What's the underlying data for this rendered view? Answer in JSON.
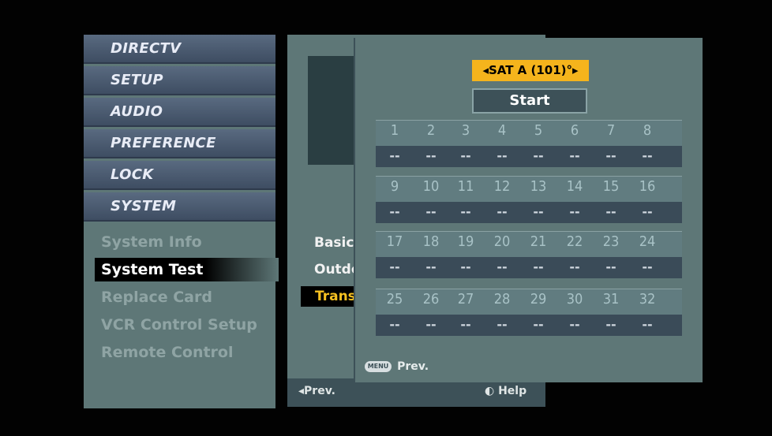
{
  "menu_tabs": [
    "DIRECTV",
    "SETUP",
    "AUDIO",
    "PREFERENCE",
    "LOCK",
    "SYSTEM"
  ],
  "system_submenu": {
    "items": [
      "System Info",
      "System Test",
      "Replace Card",
      "VCR Control Setup",
      "Remote Control"
    ],
    "selected": "System Test"
  },
  "middle_panel": {
    "items": [
      "Basic",
      "Outdo",
      "Trans"
    ],
    "selected": "Trans",
    "footer_prev": "◂Prev.",
    "footer_help": "Help"
  },
  "transponder_dialog": {
    "satellite_select": "◂SAT A (101)°▸",
    "start_button": "Start",
    "rows": [
      {
        "numbers": [
          "1",
          "2",
          "3",
          "4",
          "5",
          "6",
          "7",
          "8"
        ],
        "values": [
          "--",
          "--",
          "--",
          "--",
          "--",
          "--",
          "--",
          "--"
        ]
      },
      {
        "numbers": [
          "9",
          "10",
          "11",
          "12",
          "13",
          "14",
          "15",
          "16"
        ],
        "values": [
          "--",
          "--",
          "--",
          "--",
          "--",
          "--",
          "--",
          "--"
        ]
      },
      {
        "numbers": [
          "17",
          "18",
          "19",
          "20",
          "21",
          "22",
          "23",
          "24"
        ],
        "values": [
          "--",
          "--",
          "--",
          "--",
          "--",
          "--",
          "--",
          "--"
        ]
      },
      {
        "numbers": [
          "25",
          "26",
          "27",
          "28",
          "29",
          "30",
          "31",
          "32"
        ],
        "values": [
          "--",
          "--",
          "--",
          "--",
          "--",
          "--",
          "--",
          "--"
        ]
      }
    ],
    "footer_menu_key": "MENU",
    "footer_prev": "Prev."
  }
}
